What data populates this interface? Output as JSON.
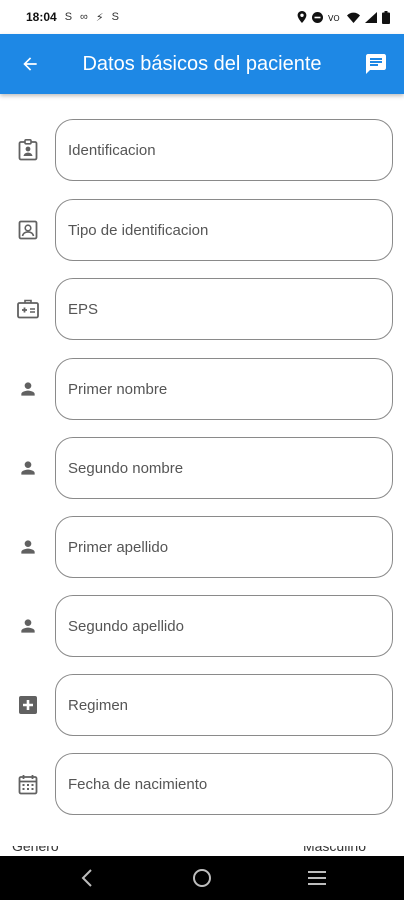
{
  "status_bar": {
    "time": "18:04",
    "left_icons": [
      "S",
      "∞",
      "⚡",
      "S"
    ]
  },
  "app_bar": {
    "title": "Datos básicos del paciente"
  },
  "fields": [
    {
      "placeholder": "Identificacion",
      "icon": "id-badge-icon"
    },
    {
      "placeholder": "Tipo de identificacion",
      "icon": "portrait-icon"
    },
    {
      "placeholder": "EPS",
      "icon": "medical-card-icon"
    },
    {
      "placeholder": "Primer nombre",
      "icon": "person-icon"
    },
    {
      "placeholder": "Segundo nombre",
      "icon": "person-icon"
    },
    {
      "placeholder": "Primer apellido",
      "icon": "person-icon"
    },
    {
      "placeholder": "Segundo apellido",
      "icon": "person-icon"
    },
    {
      "placeholder": "Regimen",
      "icon": "plus-box-icon"
    },
    {
      "placeholder": "Fecha de nacimiento",
      "icon": "calendar-icon"
    }
  ],
  "partial_row": {
    "label": "Género",
    "value": "Masculino"
  },
  "colors": {
    "primary": "#1e88e5",
    "icon_gray": "#616161"
  }
}
